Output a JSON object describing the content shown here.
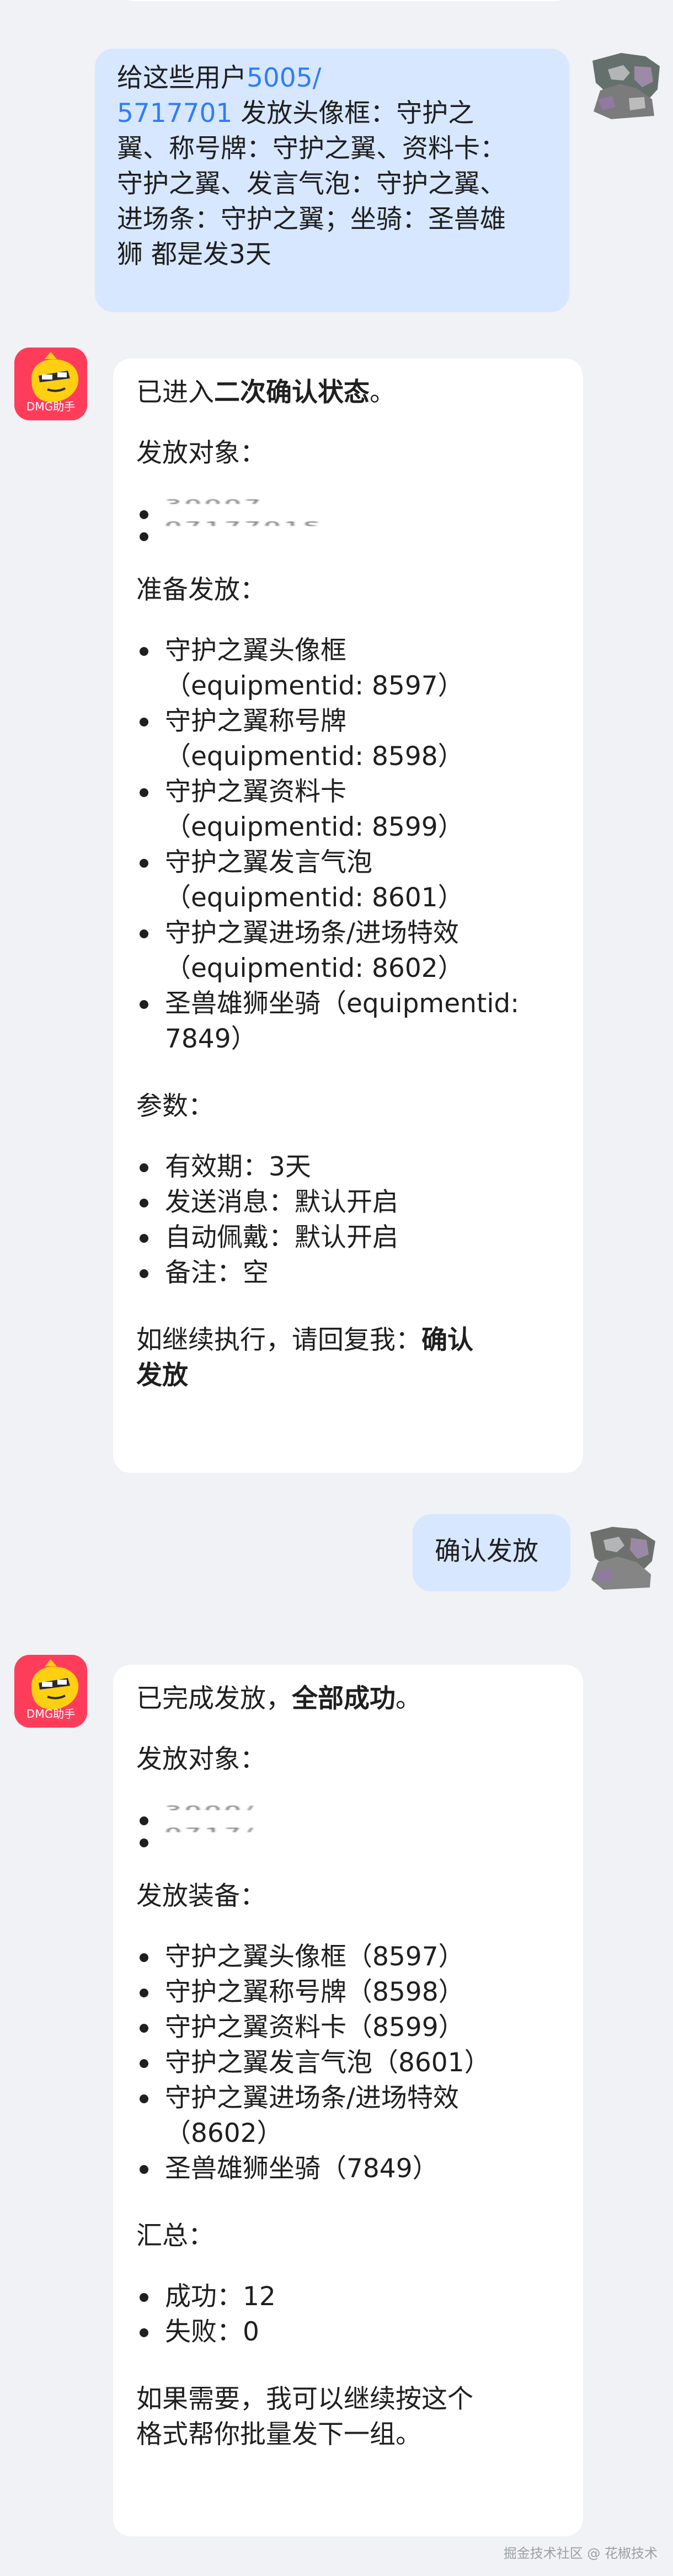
{
  "chat": {
    "message_1": {
      "lines": [
        "给这些用户",
        "发放头像框：守护之",
        "翼、称号牌：守护之翼、资料卡：",
        "守护之翼、发言气泡：守护之翼、",
        "进场条：守护之翼；坐骑：圣兽雄",
        "狮   都是发3天"
      ],
      "redacted_inline_1": "5005/",
      "redacted_inline_2": "5717701"
    },
    "response_1": {
      "intro_prefix": "已进入",
      "intro_bold": "二次确认状态",
      "intro_suffix": "。",
      "targets_title": "发放对象：",
      "targets": [
        "30007",
        "0717701S"
      ],
      "prepare_title": "准备发放：",
      "prepare_items": [
        "守护之翼头像框",
        "（equipmentid: 8597）",
        "守护之翼称号牌",
        "（equipmentid: 8598）",
        "守护之翼资料卡",
        "（equipmentid: 8599）",
        "守护之翼发言气泡",
        "（equipmentid: 8601）",
        "守护之翼进场条/进场特效",
        "（equipmentid: 8602）",
        "圣兽雄狮坐骑（equipmentid:",
        "7849）"
      ],
      "params_title": "参数：",
      "params": [
        "有效期：3天",
        "发送消息：默认开启",
        "自动佩戴：默认开启",
        "备注：空"
      ],
      "confirm_prefix": "如继续执行，请回复我：",
      "confirm_bold_1": "确认",
      "confirm_bold_2": "发放"
    },
    "message_2": {
      "text": "确认发放"
    },
    "response_2": {
      "intro_prefix": "已完成发放，",
      "intro_bold": "全部成功",
      "intro_suffix": "。",
      "targets_title": "发放对象：",
      "targets": [
        "3000/",
        "0717/"
      ],
      "items_title": "发放装备：",
      "items": [
        "守护之翼头像框（8597）",
        "守护之翼称号牌（8598）",
        "守护之翼资料卡（8599）",
        "守护之翼发言气泡（8601）",
        "守护之翼进场条/进场特效",
        "（8602）",
        "圣兽雄狮坐骑（7849）"
      ],
      "summary_title": "汇总：",
      "summary": [
        "成功：12",
        "失败：0"
      ],
      "closing_1": "如果需要，我可以继续按这个",
      "closing_2": "格式帮你批量发下一组。"
    }
  },
  "assistant": {
    "avatar_label": "DMG助手"
  },
  "watermark": "掘金技术社区 @ 花椒技术",
  "colors": {
    "page_bg": "#f0f2f5",
    "user_bubble": "#d7e7ff",
    "bot_card": "#ffffff",
    "bot_avatar": "#ff3d5b",
    "redacted_text": "#2f7df6"
  },
  "icons": {
    "bot_avatar": "dmg-assistant-avatar",
    "user_avatar": "user-avatar-thumbnail"
  }
}
